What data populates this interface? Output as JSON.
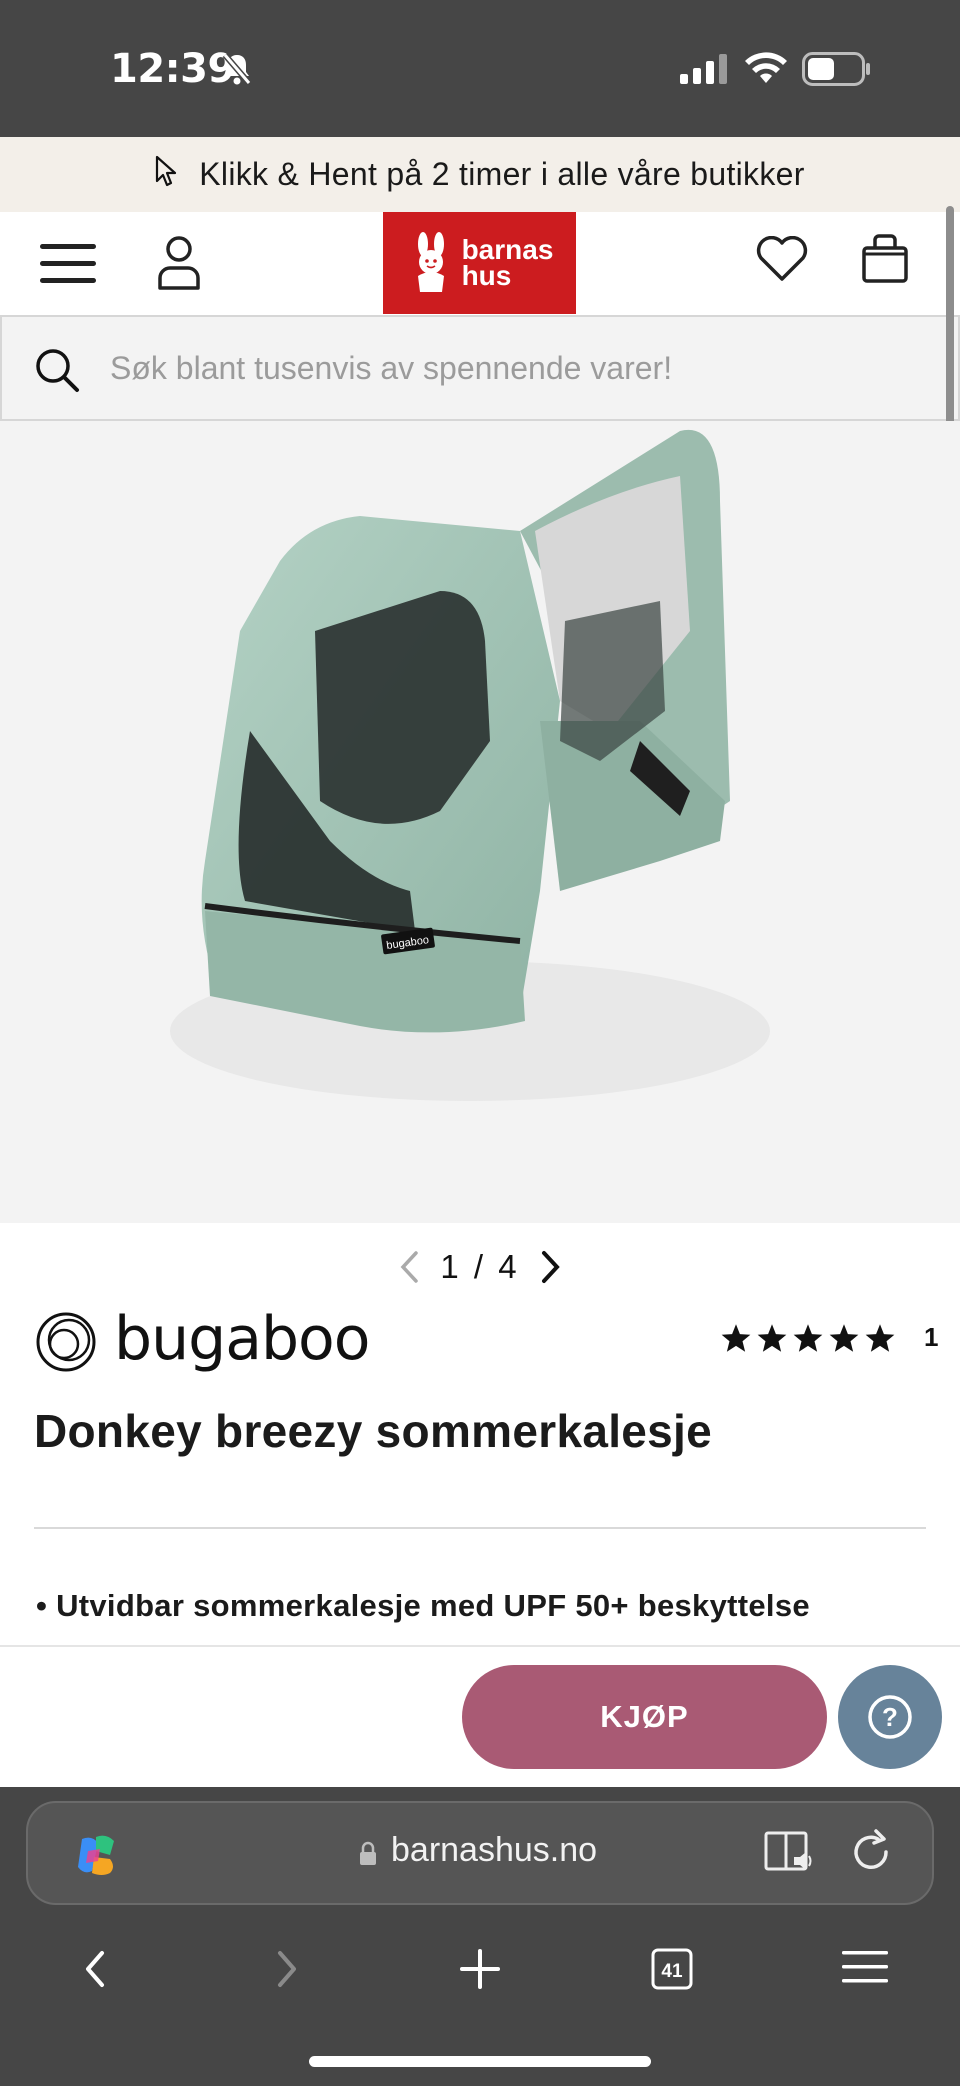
{
  "status_bar": {
    "time": "12:39"
  },
  "promo": {
    "text": "Klikk & Hent på 2 timer i alle våre butikker"
  },
  "header": {
    "logo_line1": "barnas",
    "logo_line2": "hus"
  },
  "search": {
    "placeholder": "Søk blant tusenvis av spennende varer!"
  },
  "product_image": {
    "brand_tag": "bugaboo"
  },
  "pager": {
    "current": "1",
    "separator": "/",
    "total": "4"
  },
  "brand": {
    "name": "bugaboo"
  },
  "rating": {
    "stars": 5,
    "count": "1"
  },
  "product": {
    "title": "Donkey breezy sommerkalesje",
    "bullets": [
      "• Utvidbar sommerkalesje med UPF 50+ beskyttelse"
    ]
  },
  "buy_bar": {
    "buy_label": "KJØP",
    "help_label": "?"
  },
  "browser": {
    "url": "barnashus.no",
    "tab_count": "41"
  },
  "colors": {
    "status_bg": "#464646",
    "promo_bg": "#f3efe9",
    "logo_red": "#cc1c1f",
    "buy_button": "#a95a74",
    "help_button": "#67839a",
    "canopy_green": "#9fbfb1"
  }
}
